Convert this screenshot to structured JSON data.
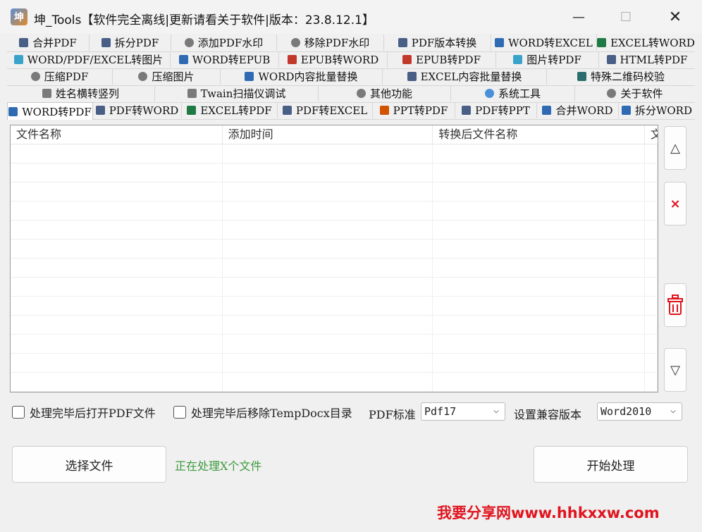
{
  "window": {
    "title": "坤_Tools【软件完全离线|更新请看关于软件|版本：23.8.12.1】",
    "min_label": "—",
    "max_label": "☐",
    "close_label": "✕"
  },
  "tabs": {
    "row1": [
      "合并PDF",
      "拆分PDF",
      "添加PDF水印",
      "移除PDF水印",
      "PDF版本转换",
      "WORD转EXCEL",
      "EXCEL转WORD"
    ],
    "row2": [
      "WORD/PDF/EXCEL转图片",
      "WORD转EPUB",
      "EPUB转WORD",
      "EPUB转PDF",
      "图片转PDF",
      "HTML转PDF"
    ],
    "row3": [
      "压缩PDF",
      "压缩图片",
      "WORD内容批量替换",
      "EXCEL内容批量替换",
      "特殊二维码校验"
    ],
    "row4": [
      "姓名横转竖列",
      "Twain扫描仪调试",
      "其他功能",
      "系统工具",
      "关于软件"
    ],
    "row5": [
      "WORD转PDF",
      "PDF转WORD",
      "EXCEL转PDF",
      "PDF转EXCEL",
      "PPT转PDF",
      "PDF转PPT",
      "合并WORD",
      "拆分WORD"
    ]
  },
  "table": {
    "columns": [
      "文件名称",
      "添加时间",
      "转换后文件名称",
      "文"
    ]
  },
  "side_buttons": {
    "up": "△",
    "remove": "×",
    "down": "▽"
  },
  "options": {
    "open_pdf_label": "处理完毕后打开PDF文件",
    "remove_temp_label": "处理完毕后移除TempDocx目录",
    "pdf_standard_label": "PDF标准",
    "pdf_standard_value": "Pdf17",
    "compat_label": "设置兼容版本",
    "compat_value": "Word2010"
  },
  "actions": {
    "select_files": "选择文件",
    "status": "正在处理X个文件",
    "start": "开始处理"
  },
  "watermark": "我要分享网www.hhkxxw.com",
  "colors": {
    "accent_red": "#e0141e",
    "status_green": "#3c9a3c"
  }
}
